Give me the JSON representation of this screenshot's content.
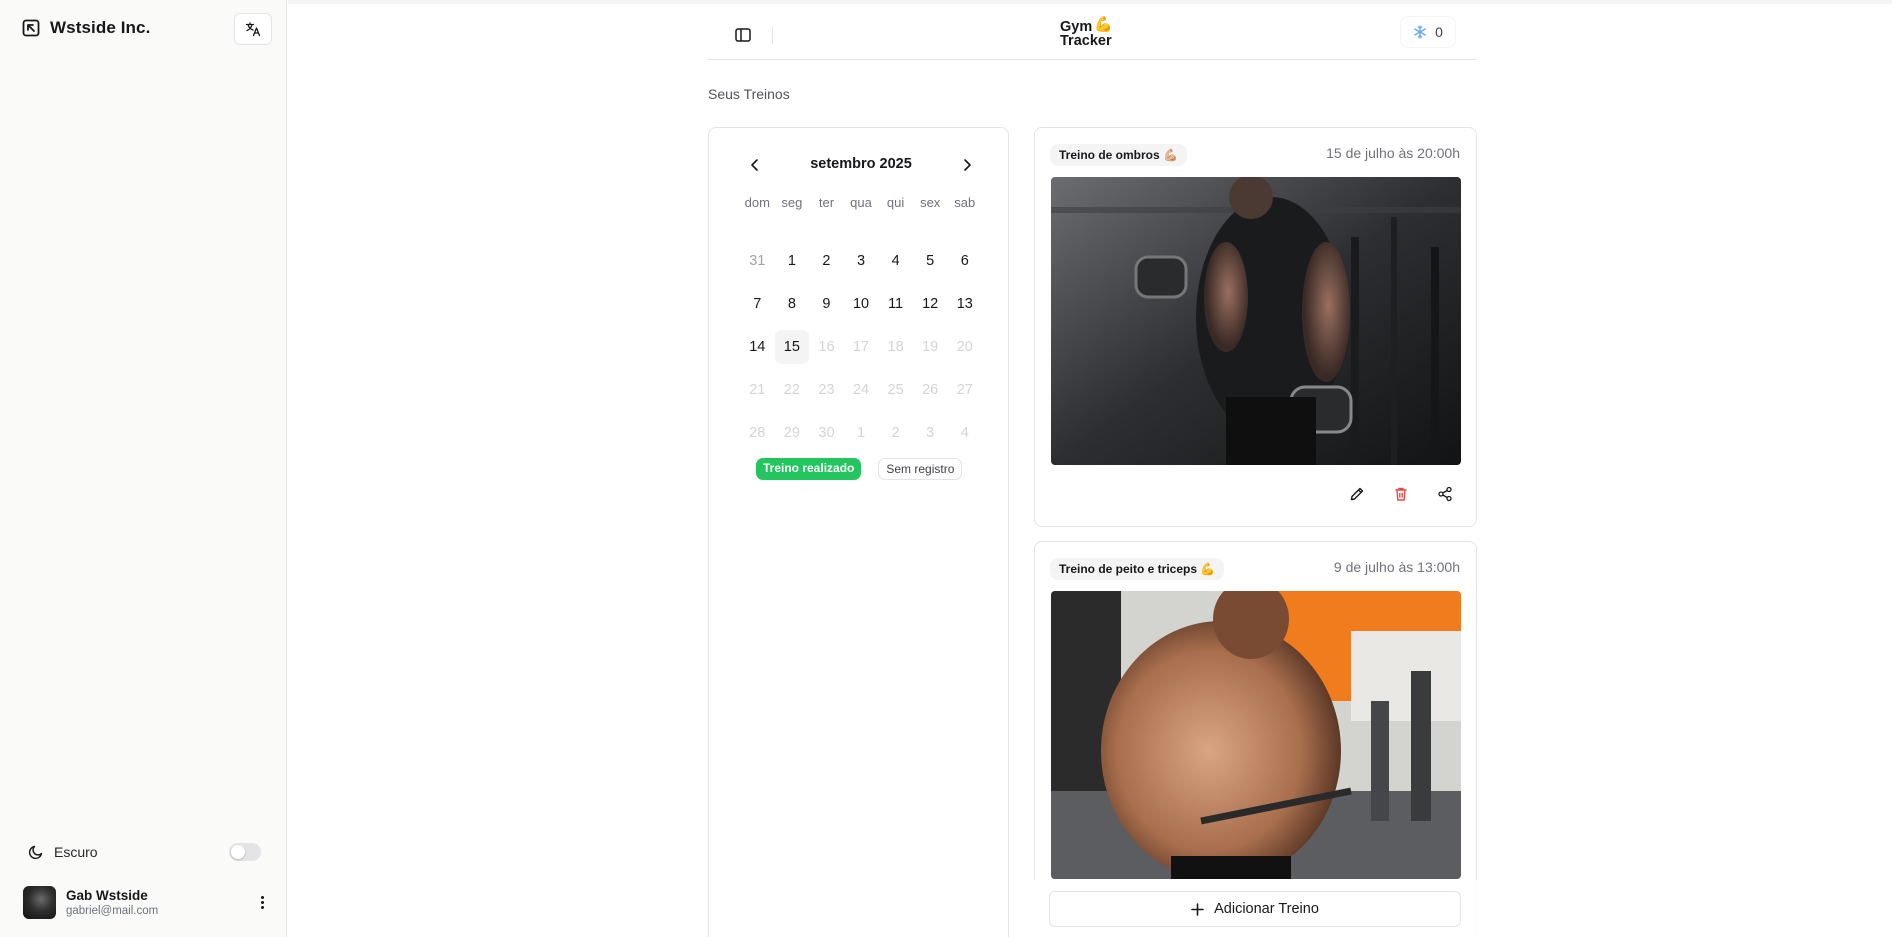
{
  "sidebar": {
    "org_name": "Wstside Inc.",
    "theme_label": "Escuro",
    "theme_dark": false,
    "user": {
      "name": "Gab Wstside",
      "email": "gabriel@mail.com"
    }
  },
  "header": {
    "logo_line1": "Gym",
    "logo_line2": "Tracker",
    "logo_emoji": "💪",
    "streak_count": "0"
  },
  "main": {
    "section_title": "Seus Treinos",
    "calendar": {
      "month_label": "setembro 2025",
      "weekdays": [
        "dom",
        "seg",
        "ter",
        "qua",
        "qui",
        "sex",
        "sab"
      ],
      "weeks": [
        [
          {
            "d": "31",
            "s": "muted"
          },
          {
            "d": "1",
            "s": ""
          },
          {
            "d": "2",
            "s": ""
          },
          {
            "d": "3",
            "s": ""
          },
          {
            "d": "4",
            "s": ""
          },
          {
            "d": "5",
            "s": ""
          },
          {
            "d": "6",
            "s": ""
          }
        ],
        [
          {
            "d": "7",
            "s": ""
          },
          {
            "d": "8",
            "s": ""
          },
          {
            "d": "9",
            "s": ""
          },
          {
            "d": "10",
            "s": ""
          },
          {
            "d": "11",
            "s": ""
          },
          {
            "d": "12",
            "s": ""
          },
          {
            "d": "13",
            "s": ""
          }
        ],
        [
          {
            "d": "14",
            "s": ""
          },
          {
            "d": "15",
            "s": "today"
          },
          {
            "d": "16",
            "s": "disabled"
          },
          {
            "d": "17",
            "s": "disabled"
          },
          {
            "d": "18",
            "s": "disabled"
          },
          {
            "d": "19",
            "s": "disabled"
          },
          {
            "d": "20",
            "s": "disabled"
          }
        ],
        [
          {
            "d": "21",
            "s": "disabled"
          },
          {
            "d": "22",
            "s": "disabled"
          },
          {
            "d": "23",
            "s": "disabled"
          },
          {
            "d": "24",
            "s": "disabled"
          },
          {
            "d": "25",
            "s": "disabled"
          },
          {
            "d": "26",
            "s": "disabled"
          },
          {
            "d": "27",
            "s": "disabled"
          }
        ],
        [
          {
            "d": "28",
            "s": "disabled"
          },
          {
            "d": "29",
            "s": "disabled"
          },
          {
            "d": "30",
            "s": "disabled"
          },
          {
            "d": "1",
            "s": "disabled"
          },
          {
            "d": "2",
            "s": "disabled"
          },
          {
            "d": "3",
            "s": "disabled"
          },
          {
            "d": "4",
            "s": "disabled"
          }
        ]
      ],
      "legend_done": "Treino realizado",
      "legend_none": "Sem registro",
      "done_color": "#22c55e"
    },
    "workouts": [
      {
        "title": "Treino de ombros 💪🏼",
        "date": "15 de julho às 20:00h"
      },
      {
        "title": "Treino de peito e triceps 💪",
        "date": "9 de julho às 13:00h"
      }
    ],
    "add_button_label": "Adicionar Treino"
  },
  "icons": {
    "org_logo": "arrow-up-left-box-icon",
    "language": "translate-icon",
    "theme": "moon-icon",
    "sidebar_toggle": "panel-left-icon",
    "streak": "snowflake-icon",
    "edit": "pencil-icon",
    "delete": "trash-icon",
    "share": "share-icon",
    "add": "plus-icon"
  }
}
